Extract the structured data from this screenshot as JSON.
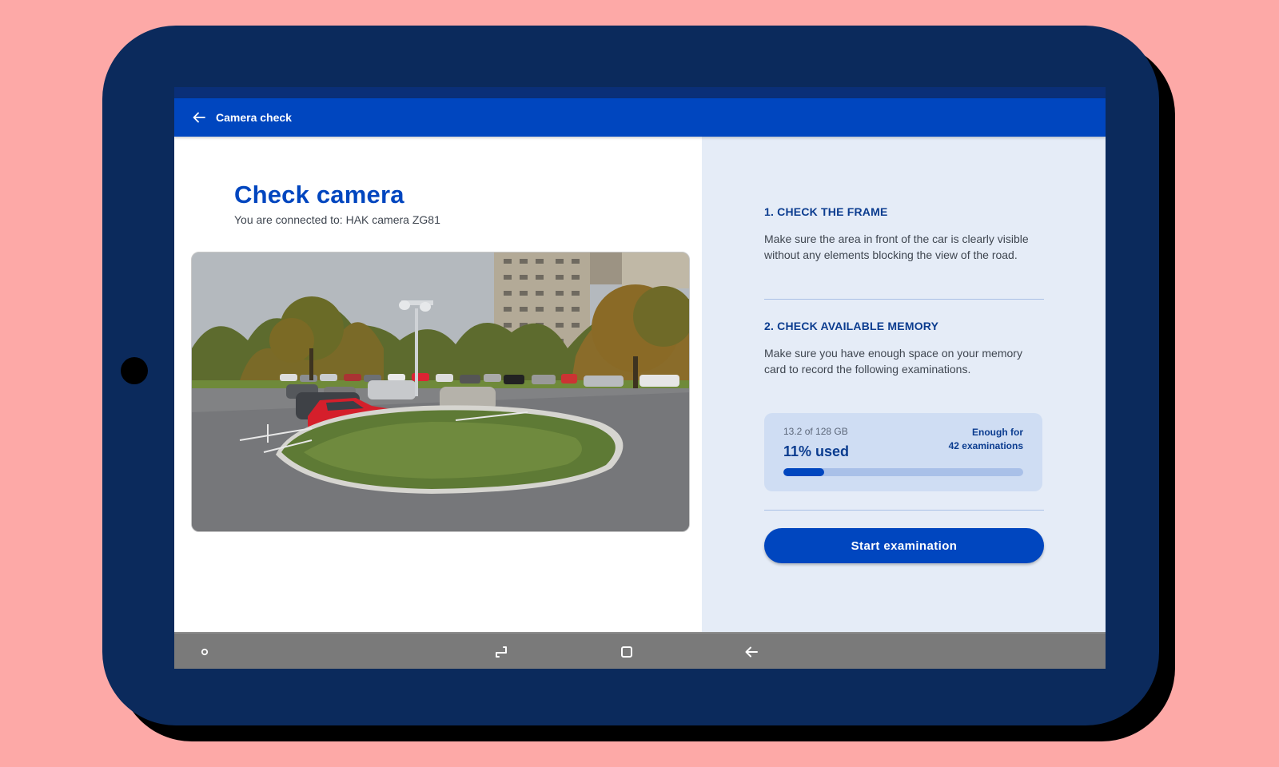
{
  "app_bar": {
    "title": "Camera check"
  },
  "main": {
    "title": "Check camera",
    "connected_prefix": "You are connected to:",
    "camera_name": "HAK camera ZG81"
  },
  "steps": [
    {
      "heading": "1. CHECK THE FRAME",
      "body": "Make sure the area in front of the car is clearly visible without any elements blocking the view of the road."
    },
    {
      "heading": "2. CHECK AVAILABLE MEMORY",
      "body": "Make sure you have enough space on your memory card to record the following examinations."
    }
  ],
  "memory": {
    "size_text": "13.2 of 128 GB",
    "used_text": "11% used",
    "used_fraction": 0.17,
    "enough_line1": "Enough for",
    "enough_line2": "42 examinations"
  },
  "actions": {
    "start_label": "Start examination"
  },
  "nav": {
    "icons": [
      "home-dot-icon",
      "recent-apps-icon",
      "overview-icon",
      "back-icon"
    ]
  },
  "colors": {
    "background": "#fda9a7",
    "tablet": "#0b2a5c",
    "primary": "#0046bf",
    "panel": "#e5ecf7",
    "navbar": "#7a7a7a"
  }
}
